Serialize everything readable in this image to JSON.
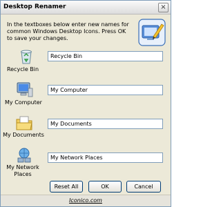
{
  "window": {
    "title": "Desktop Renamer",
    "close_glyph": "×"
  },
  "intro": {
    "text": "In the textboxes below enter new names for common Windows Desktop Icons. Press OK to save your changes."
  },
  "logo": {
    "icon": "desktop-pen-logo"
  },
  "items": [
    {
      "label": "Recycle Bin",
      "value": "Recycle Bin",
      "icon": "recycle-bin-icon"
    },
    {
      "label": "My Computer",
      "value": "My Computer",
      "icon": "computer-icon"
    },
    {
      "label": "My Documents",
      "value": "My Documents",
      "icon": "documents-folder-icon"
    },
    {
      "label": "My Network Places",
      "value": "My Network Places",
      "icon": "network-places-icon"
    }
  ],
  "buttons": {
    "reset_label": "Reset All",
    "ok_label": "OK",
    "cancel_label": "Cancel"
  },
  "footer": {
    "link_text": "Iconico.com"
  },
  "colors": {
    "window_bg": "#ece9d8",
    "button_border": "#003c74",
    "input_border": "#7f9db9"
  }
}
